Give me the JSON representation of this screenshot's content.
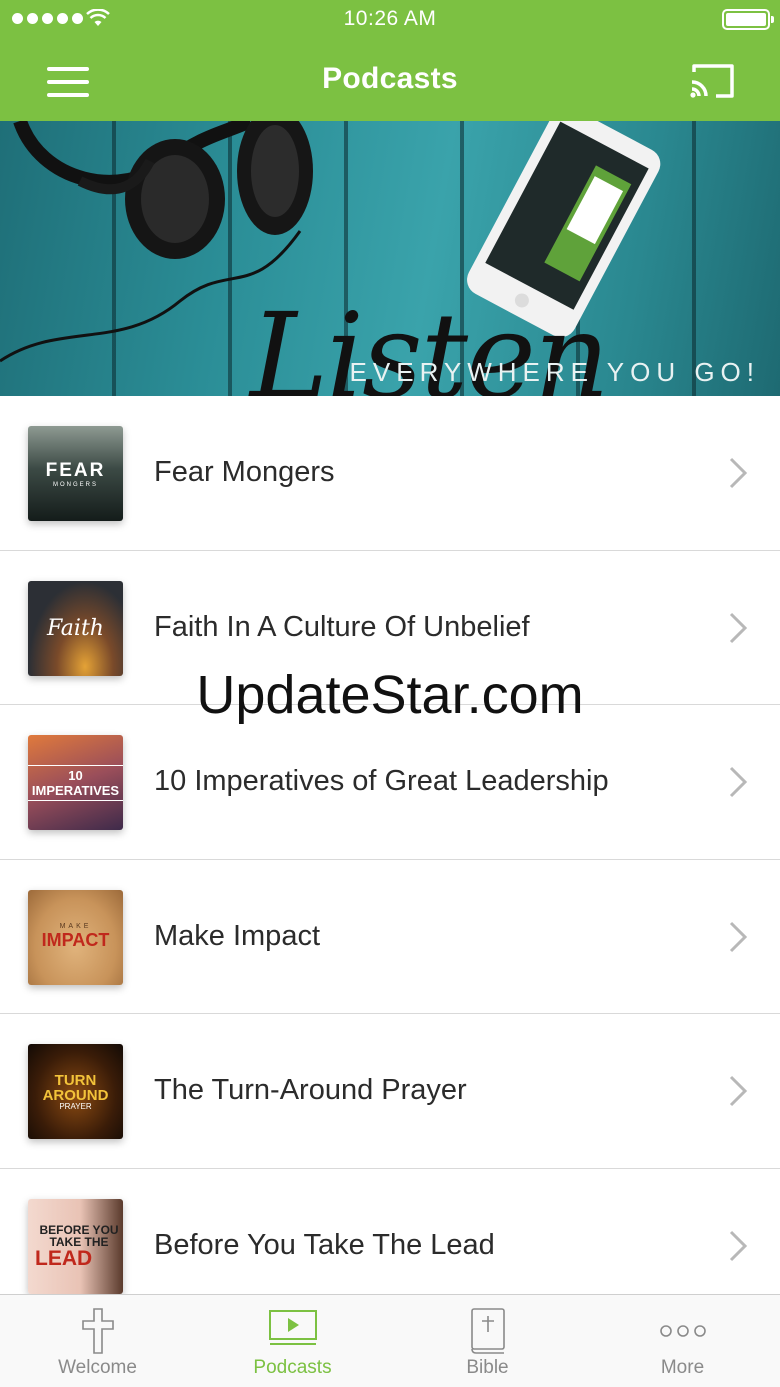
{
  "status_bar": {
    "time": "10:26 AM",
    "signal_dots": 5
  },
  "nav": {
    "title": "Podcasts",
    "menu_icon": "hamburger-menu-icon",
    "cast_icon": "cast-icon"
  },
  "hero": {
    "script_text": "Listen",
    "tagline": "EVERYWHERE YOU GO!"
  },
  "podcasts": [
    {
      "title": "Fear Mongers",
      "art_text": "FEAR",
      "art_subtext": "MONGERS"
    },
    {
      "title": "Faith In A Culture Of Unbelief",
      "art_text": "Faith"
    },
    {
      "title": "10 Imperatives of Great Leadership",
      "art_text": "10 IMPERATIVES"
    },
    {
      "title": "Make Impact",
      "art_text": "IMPACT",
      "art_subtext": "MAKE"
    },
    {
      "title": "The Turn-Around Prayer",
      "art_text": "TURN AROUND",
      "art_subtext": "PRAYER"
    },
    {
      "title": "Before You Take The Lead",
      "art_text": "LEAD",
      "art_subtext": "BEFORE YOU TAKE THE"
    }
  ],
  "watermark": "UpdateStar.com",
  "tabs": [
    {
      "label": "Welcome",
      "icon": "cross-icon",
      "active": false
    },
    {
      "label": "Podcasts",
      "icon": "video-play-icon",
      "active": true
    },
    {
      "label": "Bible",
      "icon": "bible-icon",
      "active": false
    },
    {
      "label": "More",
      "icon": "more-dots-icon",
      "active": false
    }
  ],
  "colors": {
    "brand_green": "#7cc142",
    "inactive_tab": "#8a8a8a"
  }
}
